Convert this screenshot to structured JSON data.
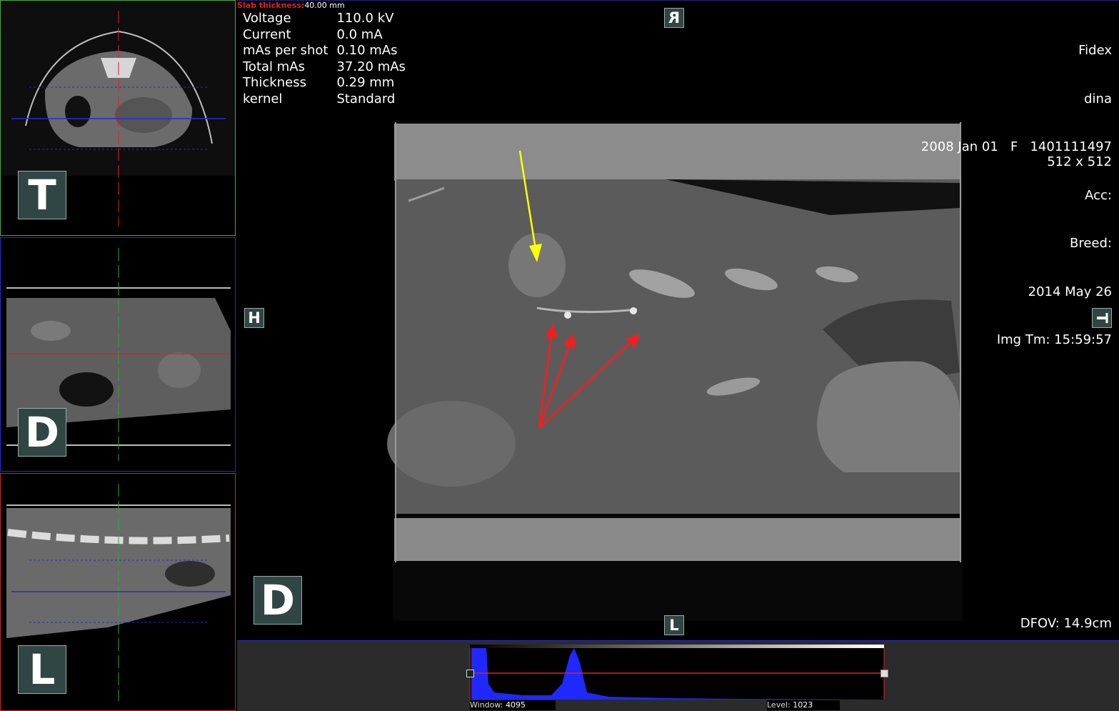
{
  "slab": {
    "label": "Slab thickness:",
    "value": "40.00 mm"
  },
  "acquisition": [
    {
      "name": "Voltage",
      "value": "110.0 kV"
    },
    {
      "name": "Current",
      "value": "0.0 mA"
    },
    {
      "name": "mAs per shot",
      "value": "0.10 mAs"
    },
    {
      "name": "Total mAs",
      "value": "37.20 mAs"
    },
    {
      "name": "Thickness",
      "value": "0.29 mm"
    },
    {
      "name": "kernel",
      "value": "Standard"
    }
  ],
  "patient": {
    "name": "Fidex",
    "owner": "dina",
    "dob_line": "2008 Jan 01   F   1401111497",
    "acc": "Acc:",
    "breed": "Breed:",
    "study_date": "2014 May 26",
    "img_time": "Img Tm: 15:59:57",
    "matrix": "512 x 512",
    "dfov": "DFOV: 14.9cm"
  },
  "orientation": {
    "thumb_axial": "T",
    "thumb_dorsal": "D",
    "thumb_lateral": "L",
    "main_plane": "D",
    "main_top": "R",
    "main_bottom": "L",
    "main_left": "H",
    "main_right": "T"
  },
  "windowing": {
    "window_label": "Window:",
    "window_value": "4095",
    "level_label": "Level:",
    "level_value": "1023"
  },
  "colors": {
    "axial_border": "#4caa3c",
    "dorsal_border": "#2a2ad0",
    "lateral_border": "#c82828",
    "histogram_fill": "#1f28ff",
    "annotation_yellow": "#ffff00",
    "annotation_red": "#ff1a1a"
  }
}
